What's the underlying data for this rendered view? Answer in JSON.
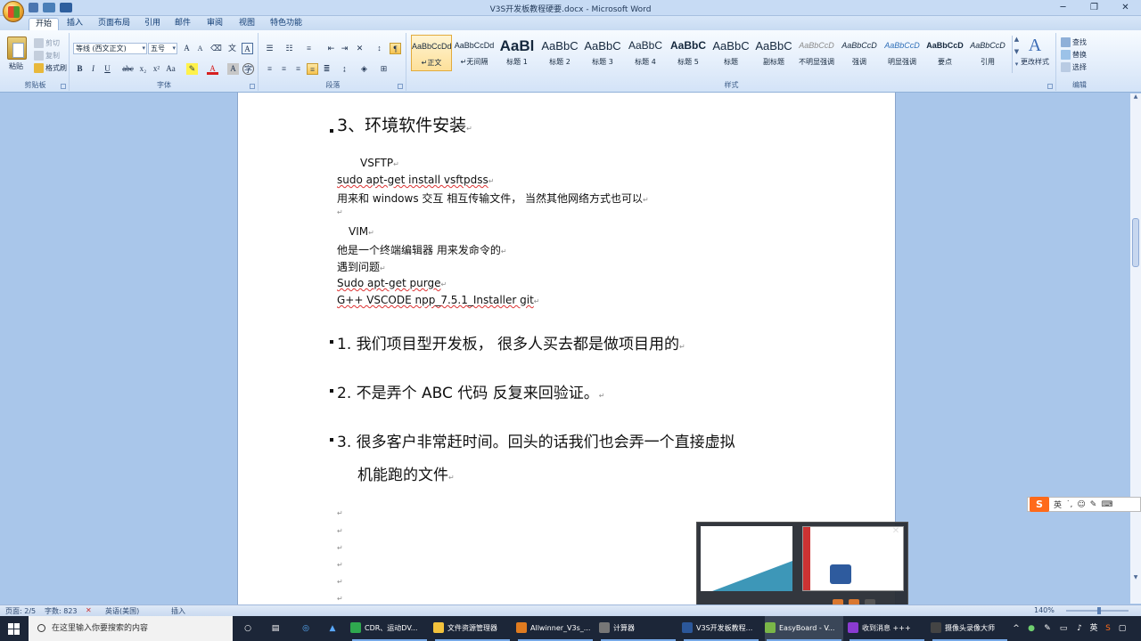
{
  "window": {
    "title": "V3S开发板教程硬要.docx - Microsoft Word",
    "controls": [
      "─",
      "❐",
      "✕"
    ]
  },
  "tabs": [
    "开始",
    "插入",
    "页面布局",
    "引用",
    "邮件",
    "审阅",
    "视图",
    "特色功能"
  ],
  "ribbon": {
    "clipboard": {
      "label": "剪贴板",
      "paste": "粘贴",
      "cut": "剪切",
      "copy": "复制",
      "format_painter": "格式刷"
    },
    "font": {
      "label": "字体",
      "font_name": "等线 (西文正文)",
      "font_size": "五号"
    },
    "paragraph": {
      "label": "段落"
    },
    "styles": {
      "label": "样式",
      "items": [
        {
          "sample": "AaBbCcDd",
          "name": "↵正文"
        },
        {
          "sample": "AaBbCcDd",
          "name": "↵无间隔"
        },
        {
          "sample": "AaBl",
          "name": "标题 1"
        },
        {
          "sample": "AaBbC",
          "name": "标题 2"
        },
        {
          "sample": "AaBbC",
          "name": "标题 3"
        },
        {
          "sample": "AaBbC",
          "name": "标题 4"
        },
        {
          "sample": "AaBbC",
          "name": "标题 5"
        },
        {
          "sample": "AaBbC",
          "name": "标题"
        },
        {
          "sample": "AaBbC",
          "name": "副标题"
        },
        {
          "sample": "AaBbCcD",
          "name": "不明显强调"
        },
        {
          "sample": "AaBbCcD",
          "name": "强调"
        },
        {
          "sample": "AaBbCcD",
          "name": "明显强调"
        },
        {
          "sample": "AaBbCcD",
          "name": "要点"
        },
        {
          "sample": "AaBbCcD",
          "name": "引用"
        }
      ],
      "change_styles": "更改样式"
    },
    "editing": {
      "label": "编辑",
      "find": "查找",
      "replace": "替换",
      "select": "选择"
    }
  },
  "document": {
    "heading": "3、环境软件安装",
    "lines": [
      "VSFTP",
      "sudo apt-get install vsftpdss",
      "用来和 windows 交互 相互传输文件， 当然其他网络方式也可以",
      "VIM",
      "他是一个终端编辑器 用来发命令的",
      "遇到问题",
      "Sudo apt-get purge",
      "G++    VSCODE    npp_7.5.1_Installer git"
    ],
    "numbered": [
      "1.  我们项目型开发板，  很多人买去都是做项目用的",
      "2.  不是弄个 ABC 代码  反复来回验证。",
      "3.  很多客户非常赶时间。回头的话我们也会弄一个直接虚拟",
      "机能跑的文件"
    ],
    "para_mark": "↵"
  },
  "status": {
    "page": "页面: 2/5",
    "words": "字数: 823",
    "language": "英语(美国)",
    "mode": "插入",
    "zoom": "140%"
  },
  "taskbar": {
    "search_placeholder": "在这里输入你要搜索的内容",
    "items": [
      {
        "label": "CDR、运动DV...",
        "color": "#2fa84f"
      },
      {
        "label": "文件资源管理器",
        "color": "#f3c23c"
      },
      {
        "label": "Allwinner_V3s_...",
        "color": "#e07b1f"
      },
      {
        "label": "计算器",
        "color": "#555555"
      },
      {
        "label": "V3S开发板教程...",
        "color": "#2b579a"
      },
      {
        "label": "EasyBoard - V...",
        "color": "#7ab648"
      },
      {
        "label": "收到消息 +++",
        "color": "#8a3bd1"
      },
      {
        "label": "摄像头录像大师",
        "color": "#333333"
      }
    ],
    "tray_lang": "英"
  },
  "ime": {
    "logo": "S",
    "mode": "英"
  }
}
